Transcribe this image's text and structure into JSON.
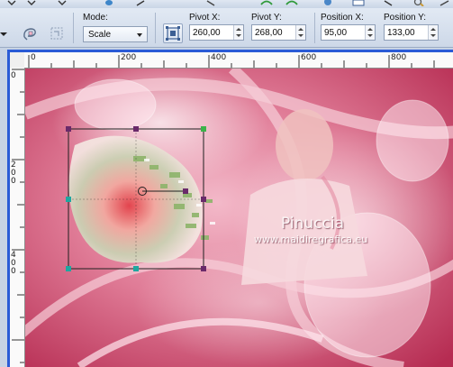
{
  "toolbar": {
    "mode_label": "Mode:",
    "mode_value": "Scale",
    "pivot_x_label": "Pivot X:",
    "pivot_x_value": "260,00",
    "pivot_y_label": "Pivot Y:",
    "pivot_y_value": "268,00",
    "position_x_label": "Position X:",
    "position_x_value": "95,00",
    "position_y_label": "Position Y:",
    "position_y_value": "133,00",
    "icons": [
      "lasso-pick-icon",
      "reset-pick-icon",
      "apply-icon",
      "mode-dropdown",
      "pivot-move-icon"
    ]
  },
  "ruler": {
    "horizontal": [
      "0",
      "200",
      "400",
      "600",
      "800"
    ],
    "vertical": [
      "0",
      "200",
      "400"
    ]
  },
  "canvas": {
    "watermark_title": "Pinuccia",
    "watermark_url": "www.maidiregrafica.eu",
    "colors": {
      "background_main": "#c43a5e",
      "background_light": "#f3b9c9",
      "selection_frame": "#1f1f1f",
      "handle_green": "#3cb34a",
      "handle_teal": "#1fa7a0",
      "handle_purple": "#6a2a6a",
      "frame_border": "#2a5bd6"
    }
  }
}
